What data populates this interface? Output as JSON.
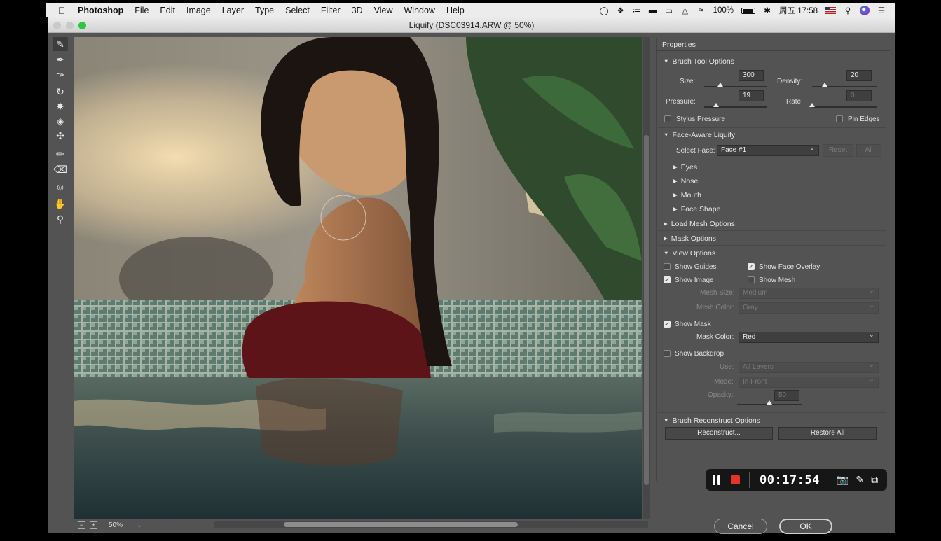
{
  "menubar": {
    "app": "Photoshop",
    "items": [
      "File",
      "Edit",
      "Image",
      "Layer",
      "Type",
      "Select",
      "Filter",
      "3D",
      "View",
      "Window",
      "Help"
    ],
    "battery": "100%",
    "clock": "周五 17:58"
  },
  "window": {
    "title": "Liquify (DSC03914.ARW @ 50%)"
  },
  "statusbar": {
    "zoom": "50%"
  },
  "properties": {
    "title": "Properties",
    "brush": {
      "header": "Brush Tool Options",
      "size_label": "Size:",
      "size": "300",
      "size_level": 0.25,
      "density_label": "Density:",
      "density": "20",
      "density_level": 0.2,
      "pressure_label": "Pressure:",
      "pressure": "19",
      "pressure_level": 0.19,
      "rate_label": "Rate:",
      "rate": "0",
      "rate_level": 0.0,
      "stylus": "Stylus Pressure",
      "stylus_checked": false,
      "pin_edges": "Pin Edges",
      "pin_edges_checked": false
    },
    "face": {
      "header": "Face-Aware Liquify",
      "select_label": "Select Face:",
      "select_value": "Face #1",
      "reset": "Reset",
      "all": "All",
      "groups": [
        "Eyes",
        "Nose",
        "Mouth",
        "Face Shape"
      ]
    },
    "load_mesh": "Load Mesh Options",
    "mask_options": "Mask Options",
    "view": {
      "header": "View Options",
      "show_guides": "Show Guides",
      "show_guides_checked": false,
      "show_face_overlay": "Show Face Overlay",
      "show_face_overlay_checked": true,
      "show_image": "Show Image",
      "show_image_checked": true,
      "show_mesh": "Show Mesh",
      "show_mesh_checked": false,
      "mesh_size_label": "Mesh Size:",
      "mesh_size": "Medium",
      "mesh_color_label": "Mesh Color:",
      "mesh_color": "Gray",
      "show_mask": "Show Mask",
      "show_mask_checked": true,
      "mask_color_label": "Mask Color:",
      "mask_color": "Red",
      "show_backdrop": "Show Backdrop",
      "show_backdrop_checked": false,
      "use_label": "Use:",
      "use": "All Layers",
      "mode_label": "Mode:",
      "mode": "In Front",
      "opacity_label": "Opacity:",
      "opacity": "50",
      "opacity_level": 0.5
    },
    "reconstruct": {
      "header": "Brush Reconstruct Options",
      "reconstruct": "Reconstruct...",
      "restore_all": "Restore All"
    }
  },
  "recorder": {
    "time": "00:17:54"
  },
  "buttons": {
    "cancel": "Cancel",
    "ok": "OK"
  },
  "colors": {
    "accent_green": "#2cc841",
    "record_red": "#e5332a",
    "panel": "#535353"
  },
  "icons": [
    "apple-icon",
    "wifi-icon",
    "bluetooth-icon",
    "search-icon",
    "camera-icon",
    "pen-icon",
    "window-icon"
  ]
}
